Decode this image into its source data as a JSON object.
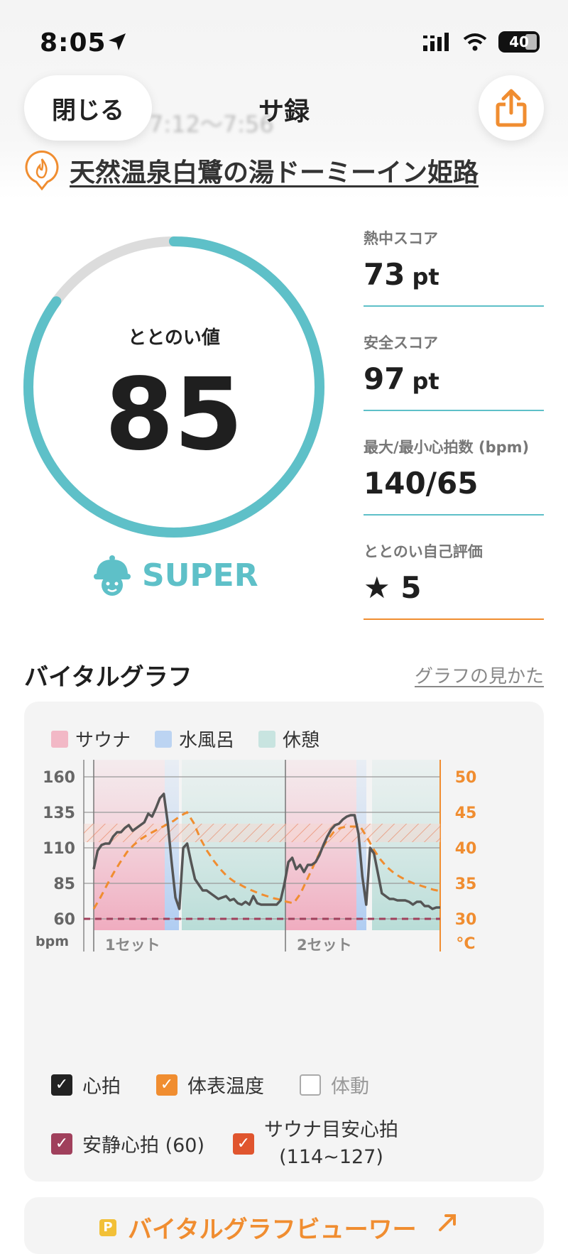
{
  "status": {
    "time": "8:05",
    "battery": "40"
  },
  "header": {
    "close_label": "閉じる",
    "title": "サ録",
    "blurred_time": "7:12〜7:56"
  },
  "facility": {
    "name": "天然温泉白鷺の湯ドーミーイン姫路"
  },
  "gauge": {
    "label": "ととのい値",
    "value": "85",
    "max": 100,
    "grade": "SUPER"
  },
  "scores": [
    {
      "label": "熱中スコア",
      "value": "73",
      "unit": "pt"
    },
    {
      "label": "安全スコア",
      "value": "97",
      "unit": "pt"
    },
    {
      "label": "最大/最小心拍数 (bpm)",
      "value": "140/65",
      "unit": ""
    },
    {
      "label": "ととのい自己評価",
      "value": "★ 5",
      "unit": ""
    }
  ],
  "section": {
    "title": "バイタルグラフ",
    "link": "グラフの見かた"
  },
  "legend": [
    {
      "label": "サウナ",
      "color": "#f2b8c6"
    },
    {
      "label": "水風呂",
      "color": "#bcd4f2"
    },
    {
      "label": "休憩",
      "color": "#c8e4e0"
    }
  ],
  "colors": {
    "accent": "#5ec0c8",
    "orange": "#f08d30",
    "dark": "#1f1f1f"
  },
  "chart_data": {
    "type": "line",
    "left_axis": {
      "ticks": [
        "160",
        "135",
        "110",
        "85",
        "60"
      ],
      "unit": "bpm",
      "ylim": [
        60,
        160
      ]
    },
    "right_axis": {
      "ticks": [
        "50",
        "45",
        "40",
        "35",
        "30"
      ],
      "unit": "°C",
      "ylim": [
        30,
        50
      ]
    },
    "sets": [
      "1セット",
      "2セット"
    ],
    "series": [
      {
        "name": "心拍",
        "values": [
          95,
          108,
          112,
          113,
          113,
          118,
          121,
          121,
          124,
          126,
          122,
          124,
          126,
          128,
          134,
          132,
          138,
          145,
          148,
          128,
          100,
          75,
          67,
          110,
          113,
          100,
          88,
          84,
          80,
          80,
          78,
          76,
          74,
          75,
          76,
          73,
          74,
          71,
          70,
          72,
          70,
          76,
          71,
          70,
          70,
          70,
          70,
          70,
          73,
          85,
          100,
          103,
          95,
          98,
          93,
          98,
          98,
          100,
          105,
          112,
          118,
          123,
          126,
          127,
          130,
          132,
          133,
          133,
          120,
          90,
          70,
          110,
          106,
          92,
          78,
          76,
          74,
          74,
          73,
          73,
          73,
          72,
          70,
          72,
          72,
          69,
          69,
          67,
          68,
          68
        ]
      },
      {
        "name": "体表温度",
        "values": [
          31.4,
          33.0,
          34.8,
          36.5,
          38.0,
          39.4,
          40.4,
          41.2,
          41.8,
          42.3,
          42.8,
          43.3,
          43.8,
          44.5,
          45.0,
          43.5,
          41.3,
          39.6,
          38.2,
          37.0,
          36.0,
          35.3,
          34.8,
          34.3,
          33.9,
          33.5,
          33.2,
          32.9,
          32.7,
          32.4,
          32.2,
          33.5,
          35.5,
          37.5,
          39.5,
          41.0,
          42.2,
          42.8,
          43.0,
          43.0,
          43.0,
          41.5,
          39.8,
          38.4,
          37.3,
          36.5,
          35.9,
          35.4,
          35.0,
          34.7,
          34.4,
          34.1,
          33.9
        ],
        "dashed": true
      }
    ],
    "reference_lines": [
      {
        "name": "安静心拍",
        "value": 60
      },
      {
        "name": "サウナ目安心拍",
        "range": [
          114,
          127
        ]
      }
    ]
  },
  "checkboxes": [
    {
      "label": "心拍",
      "checked": true,
      "color": "#222222"
    },
    {
      "label": "体表温度",
      "checked": true,
      "color": "#f08d30"
    },
    {
      "label": "体動",
      "checked": false,
      "color": "#aaaaaa"
    },
    {
      "label": "安静心拍 (60)",
      "checked": true,
      "color": "#a0405c"
    },
    {
      "label": "サウナ目安心拍",
      "label2": "(114~127)",
      "checked": true,
      "color": "#e0552e"
    }
  ],
  "viewer": {
    "badge": "P",
    "label": "バイタルグラフビューワー"
  }
}
